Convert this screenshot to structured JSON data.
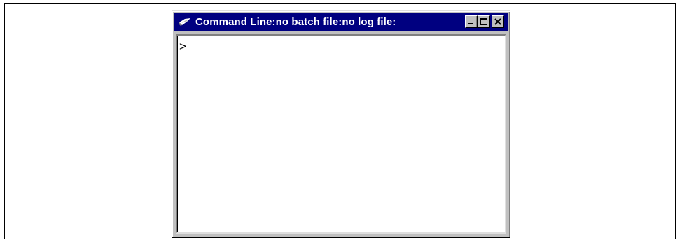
{
  "window": {
    "title": "Command Line:no batch file:no log file:",
    "icon": "app-icon",
    "controls": {
      "minimize": "minimize-icon",
      "maximize": "maximize-icon",
      "close": "close-icon"
    }
  },
  "console": {
    "prompt": ">",
    "input_value": ""
  },
  "colors": {
    "titlebar": "#000080",
    "title_text": "#ffffff",
    "chrome": "#c0c0c0",
    "console_background": "#ffffff"
  }
}
